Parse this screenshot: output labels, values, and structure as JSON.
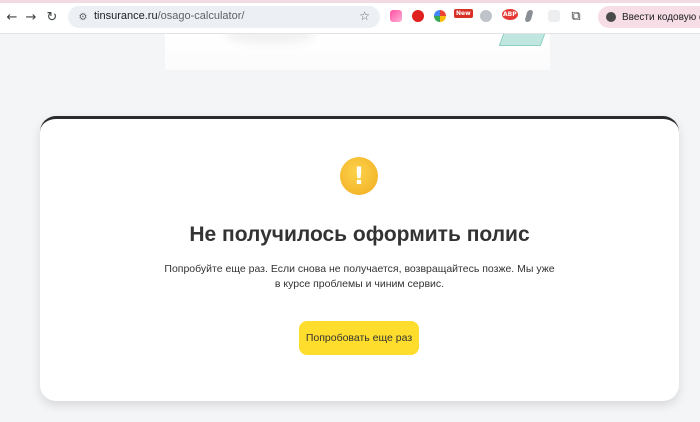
{
  "browser": {
    "url_domain": "tinsurance.ru",
    "url_path": "/osago-calculator/",
    "extensions": [
      "new-badge",
      "abp-badge"
    ],
    "new_badge": "New",
    "abp_badge": "ABP",
    "code_phrase_label": "Ввести кодовую фразу"
  },
  "error": {
    "title": "Не получилось оформить полис",
    "description_line1": "Попробуйте еще раз. Если снова не получается, возвращайтесь позже. Мы уже",
    "description_line2": "в курсе проблемы и чиним сервис.",
    "retry_label": "Попробовать еще раз",
    "icon": "exclamation-icon",
    "icon_glyph": "!"
  },
  "colors": {
    "accent_yellow": "#ffdd2d",
    "warning_orange": "#f5b72c",
    "text_dark": "#333333"
  }
}
